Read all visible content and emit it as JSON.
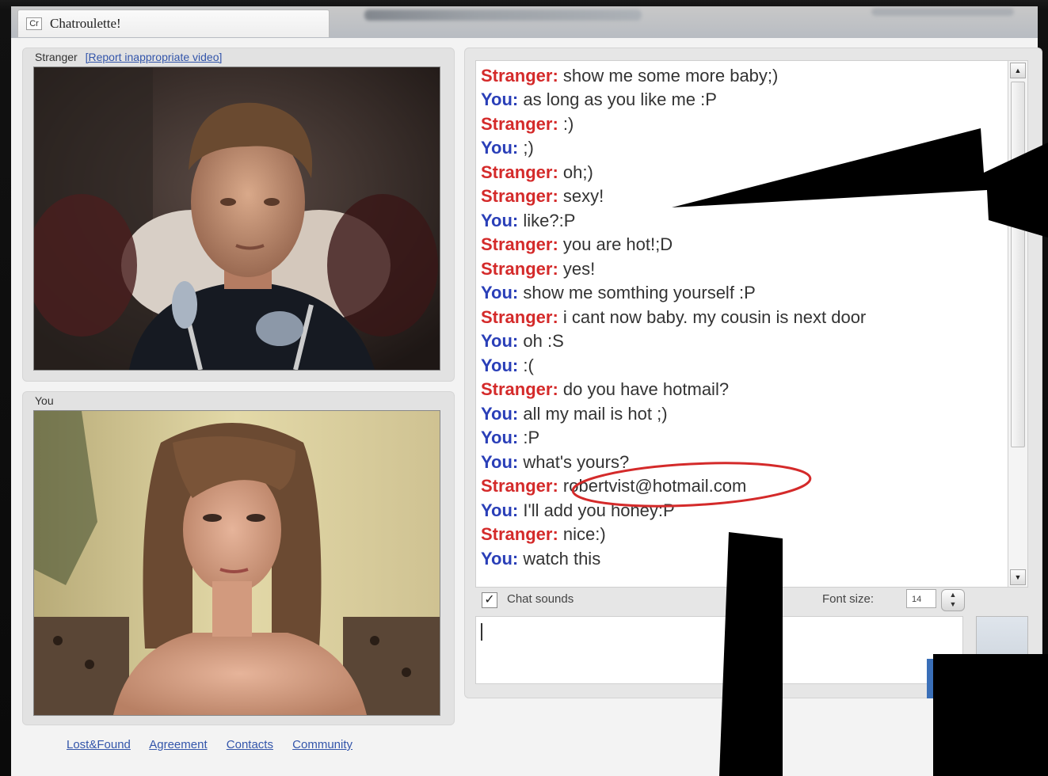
{
  "browser": {
    "tab_icon": "Cr",
    "tab_title": "Chatroulette!"
  },
  "stranger_panel": {
    "label": "Stranger",
    "report_link": "[Report inappropriate video]"
  },
  "you_panel": {
    "label": "You"
  },
  "chat": {
    "messages": [
      {
        "who": "Stranger:",
        "text": "show me some more baby;)"
      },
      {
        "who": "You:",
        "text": "as long as you like me :P"
      },
      {
        "who": "Stranger:",
        "text": ":)"
      },
      {
        "who": "You:",
        "text": ";)"
      },
      {
        "who": "Stranger:",
        "text": "oh;)"
      },
      {
        "who": "Stranger:",
        "text": "sexy!"
      },
      {
        "who": "You:",
        "text": "like?:P"
      },
      {
        "who": "Stranger:",
        "text": "you are hot!;D"
      },
      {
        "who": "Stranger:",
        "text": "yes!"
      },
      {
        "who": "You:",
        "text": "show me somthing yourself :P"
      },
      {
        "who": "Stranger:",
        "text": "i cant now baby. my cousin is next door"
      },
      {
        "who": "You:",
        "text": "oh :S"
      },
      {
        "who": "You:",
        "text": ":("
      },
      {
        "who": "Stranger:",
        "text": "do you have hotmail?"
      },
      {
        "who": "You:",
        "text": "all my mail is hot ;)"
      },
      {
        "who": "You:",
        "text": ":P"
      },
      {
        "who": "You:",
        "text": "what's yours?"
      },
      {
        "who": "Stranger:",
        "text": "robertvist@hotmail.com"
      },
      {
        "who": "You:",
        "text": "I'll add you honey:P"
      },
      {
        "who": "Stranger:",
        "text": "nice:)"
      },
      {
        "who": "You:",
        "text": "watch this"
      }
    ]
  },
  "options": {
    "chat_sounds_label": "Chat sounds",
    "chat_sounds_checked": true,
    "font_size_label": "Font size:",
    "font_size_value": "14"
  },
  "input": {
    "value": ""
  },
  "footer": {
    "links": [
      "Lost&Found",
      "Agreement",
      "Contacts",
      "Community"
    ]
  },
  "colors": {
    "stranger": "#d42a2a",
    "you": "#2a3fb8",
    "highlight_circle": "#d42a2a"
  }
}
